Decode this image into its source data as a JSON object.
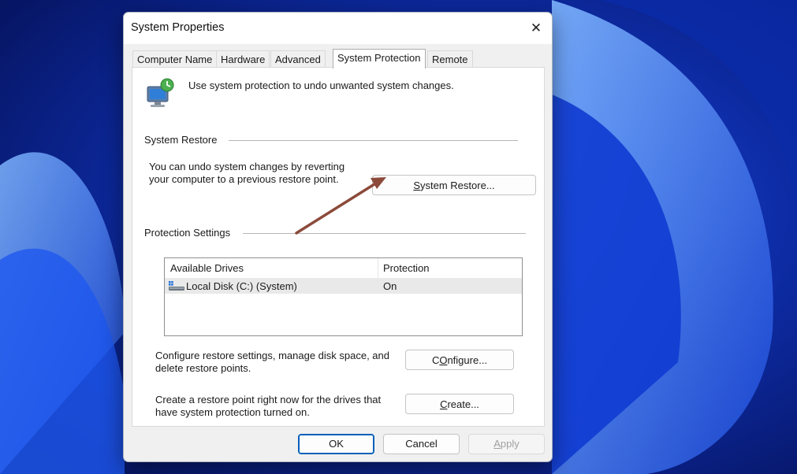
{
  "window": {
    "title": "System Properties",
    "close_glyph": "✕"
  },
  "tabs": [
    {
      "label": "Computer Name",
      "active": false
    },
    {
      "label": "Hardware",
      "active": false
    },
    {
      "label": "Advanced",
      "active": false
    },
    {
      "label": "System Protection",
      "active": true
    },
    {
      "label": "Remote",
      "active": false
    }
  ],
  "intro": {
    "icon": "system-protection-icon",
    "text": "Use system protection to undo unwanted system changes."
  },
  "system_restore": {
    "group_label": "System Restore",
    "description_line1": "You can undo system changes by reverting",
    "description_line2": "your computer to a previous restore point.",
    "button_label_underlined": "S",
    "button_label_rest": "ystem Restore..."
  },
  "protection_settings": {
    "group_label": "Protection Settings",
    "columns": [
      "Available Drives",
      "Protection"
    ],
    "rows": [
      {
        "drive": "Local Disk (C:) (System)",
        "protection": "On",
        "icon": "local-disk-icon"
      }
    ],
    "configure_text_line1": "Configure restore settings, manage disk space, and",
    "configure_text_line2": "delete restore points.",
    "configure_button_underlined": "O",
    "configure_button_prefix": "C",
    "configure_button_rest": "nfigure...",
    "create_text_line1": "Create a restore point right now for the drives that",
    "create_text_line2": "have system protection turned on.",
    "create_button_underlined": "C",
    "create_button_rest": "reate..."
  },
  "footer": {
    "ok_label": "OK",
    "cancel_label": "Cancel",
    "apply_label_underlined": "A",
    "apply_label_rest": "pply"
  },
  "colors": {
    "annotation_arrow": "#8b4a3a",
    "ok_border": "#005fb8"
  }
}
